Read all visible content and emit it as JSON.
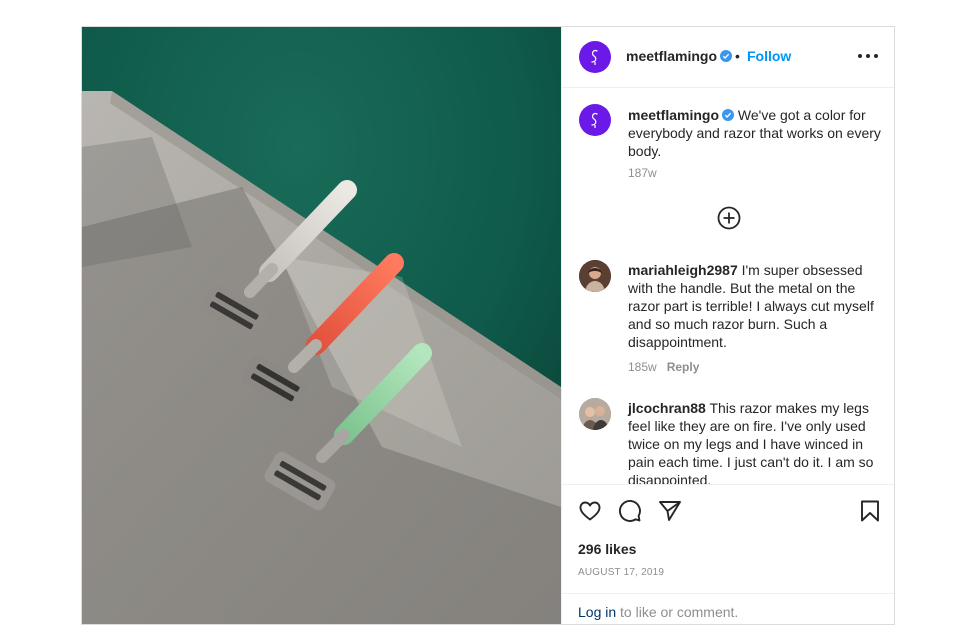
{
  "header": {
    "username": "meetflamingo",
    "verified": true,
    "separator": "•",
    "follow_label": "Follow",
    "more_icon": "more-options-icon"
  },
  "caption": {
    "username": "meetflamingo",
    "text": " We've got a color for everybody and razor that works on every body.",
    "time": "187w"
  },
  "load_more_icon": "plus-circle-icon",
  "comments": [
    {
      "username": "mariahleigh2987",
      "text": " I'm super obsessed with the handle. But the metal on the razor part is terrible! I always cut myself and so much razor burn. Such a disappointment.",
      "time": "185w",
      "reply_label": "Reply"
    },
    {
      "username": "jlcochran88",
      "text": " This razor makes my legs feel like they are on fire. I've only used twice on my legs and I have winced in pain each time. I just can't do it. I am so disappointed."
    }
  ],
  "actions": {
    "icons": [
      "heart-icon",
      "comment-icon",
      "share-icon",
      "bookmark-icon"
    ],
    "likes": "296 likes",
    "date": "AUGUST 17, 2019"
  },
  "login": {
    "link_label": "Log in",
    "rest": " to like or comment."
  },
  "colors": {
    "brand_avatar": "#6a19e6",
    "accent_blue": "#0095f6",
    "link_dark": "#00376b",
    "pool_green": "#0f5546",
    "razor_handles": [
      "#d7d3cf",
      "#f0634b",
      "#9fd8a8"
    ]
  }
}
